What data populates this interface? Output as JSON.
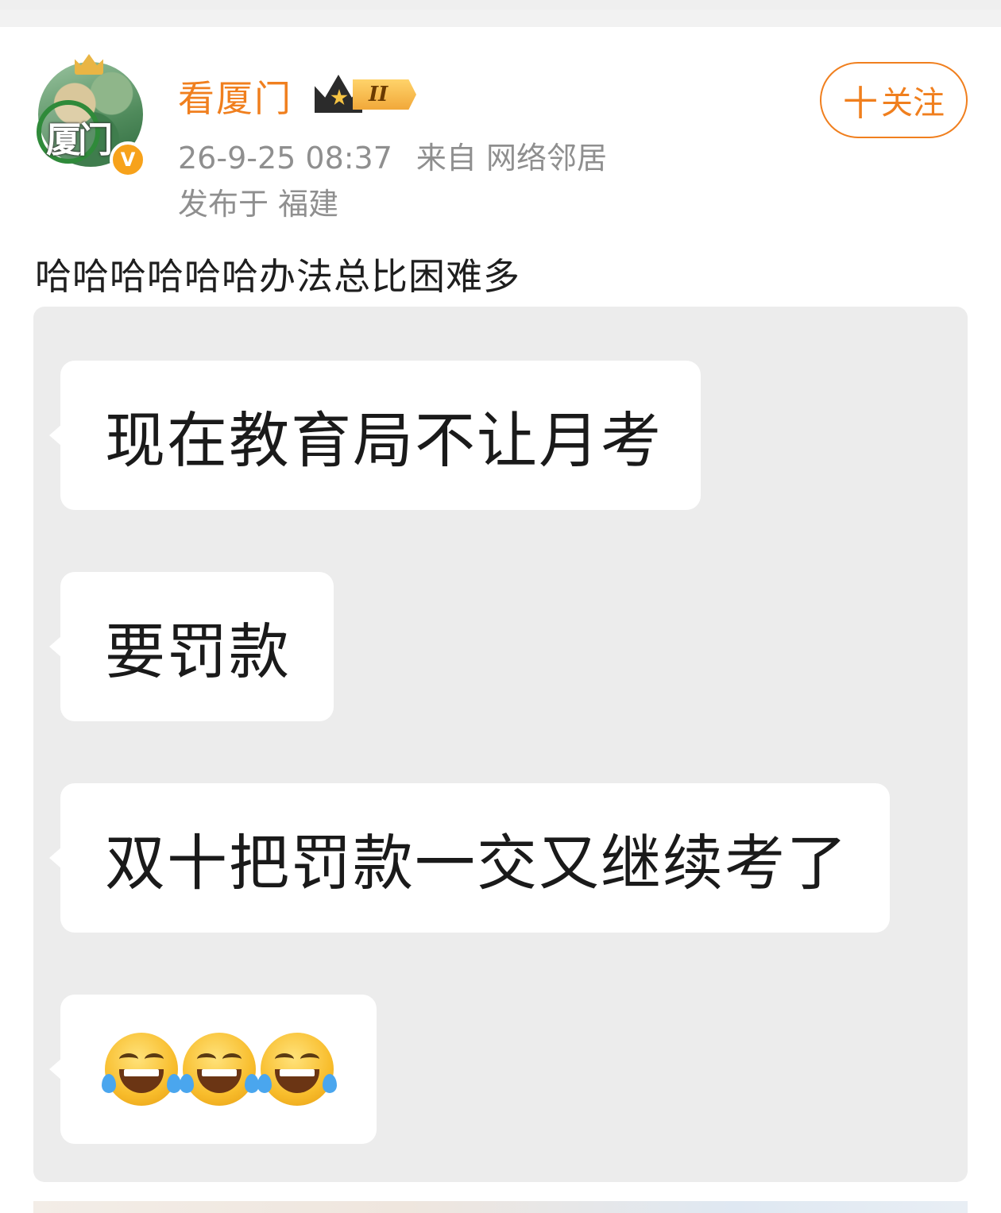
{
  "post": {
    "author": {
      "name": "看厦门",
      "avatar_glyph": "厦门",
      "level_badge": "II",
      "verified_mark": "V"
    },
    "time": "26-9-25 08:37",
    "source": "来自 网络邻居",
    "location": "发布于 福建",
    "follow_button": {
      "plus": "十",
      "label": "关注"
    },
    "text": "哈哈哈哈哈哈办法总比困难多"
  },
  "image": {
    "messages": [
      "现在教育局不让月考",
      "要罚款",
      "双十把罚款一交又继续考了"
    ],
    "emoji_message": [
      "face-with-tears-of-joy",
      "face-with-tears-of-joy",
      "face-with-tears-of-joy"
    ]
  },
  "colors": {
    "accent": "#f07f1e",
    "meta_text": "#8f8f8f",
    "card_bg": "#ececec"
  }
}
